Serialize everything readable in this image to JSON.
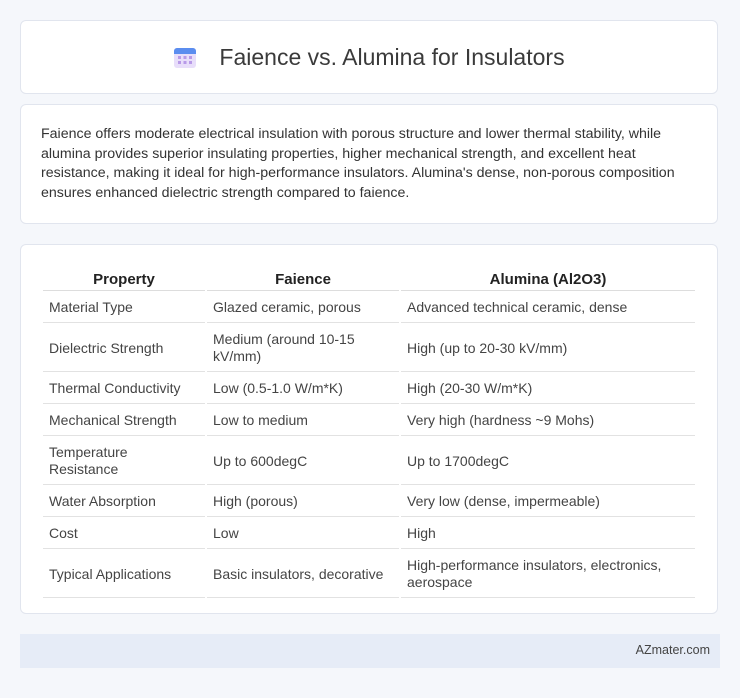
{
  "header": {
    "title": "Faience vs. Alumina for Insulators",
    "icon": "calendar-icon"
  },
  "summary": "Faience offers moderate electrical insulation with porous structure and lower thermal stability, while alumina provides superior insulating properties, higher mechanical strength, and excellent heat resistance, making it ideal for high-performance insulators. Alumina's dense, non-porous composition ensures enhanced dielectric strength compared to faience.",
  "table": {
    "headers": [
      "Property",
      "Faience",
      "Alumina (Al2O3)"
    ],
    "rows": [
      [
        "Material Type",
        "Glazed ceramic, porous",
        "Advanced technical ceramic, dense"
      ],
      [
        "Dielectric Strength",
        "Medium (around 10-15 kV/mm)",
        "High (up to 20-30 kV/mm)"
      ],
      [
        "Thermal Conductivity",
        "Low (0.5-1.0 W/m*K)",
        "High (20-30 W/m*K)"
      ],
      [
        "Mechanical Strength",
        "Low to medium",
        "Very high (hardness ~9 Mohs)"
      ],
      [
        "Temperature Resistance",
        "Up to 600degC",
        "Up to 1700degC"
      ],
      [
        "Water Absorption",
        "High (porous)",
        "Very low (dense, impermeable)"
      ],
      [
        "Cost",
        "Low",
        "High"
      ],
      [
        "Typical Applications",
        "Basic insulators, decorative",
        "High-performance insulators, electronics, aerospace"
      ]
    ]
  },
  "footer": {
    "brand": "AZmater.com"
  }
}
